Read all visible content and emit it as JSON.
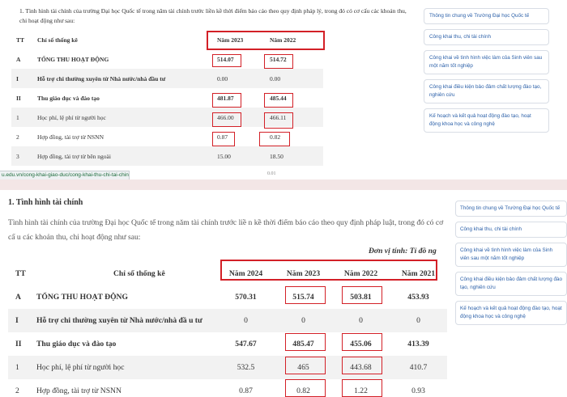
{
  "top": {
    "intro": "1. Tình hình tài chính của trường Đại học Quốc tế trong năm tài chính trước liền kề thời điểm báo cáo theo quy định pháp lý, trong đó có cơ cấu các khoản thu, chi hoạt động như sau:",
    "table": {
      "header": {
        "tt": "TT",
        "name": "Chỉ số thống kê",
        "y1": "Năm 2023",
        "y2": "Năm 2022"
      },
      "rows": [
        {
          "tt": "A",
          "name": "TỔNG THU HOẠT ĐỘNG",
          "y1": "514.07",
          "y2": "514.72"
        },
        {
          "tt": "I",
          "name": "Hỗ trợ chi thường xuyên từ Nhà nước/nhà đầu tư",
          "y1": "0.00",
          "y2": "0.00"
        },
        {
          "tt": "II",
          "name": "Thu giáo dục và đào tạo",
          "y1": "481.87",
          "y2": "485.44"
        },
        {
          "tt": "1",
          "name": "Học phí, lệ phí từ người học",
          "y1": "466.00",
          "y2": "466.11"
        },
        {
          "tt": "2",
          "name": "Hợp đồng, tài trợ từ NSNN",
          "y1": "0.87",
          "y2": "0.82"
        },
        {
          "tt": "3",
          "name": "Hợp đồng, tài trợ từ bên ngoài",
          "y1": "15.00",
          "y2": "18.50"
        }
      ],
      "cut_value": "0.01"
    },
    "sidebar": [
      "Thông tin chung về Trường Đại học Quốc tế",
      "Công khai thu, chi tài chính",
      "Công khai về tình hình việc làm của Sinh viên sau một năm tốt nghiệp",
      "Công khai điều kiện bảo đảm chất lượng đào tạo, nghiên cứu",
      "Kế hoạch và kết quả hoạt động đào tạo, hoạt động khoa học và công nghệ"
    ],
    "status_url": "u.edu.vn/cong-khai-giao-duc/cong-khai-thu-chi-tai-chinh/#"
  },
  "bottom": {
    "section_title": "1. Tình hình tài chính",
    "paragraph": "Tình hình tài chính của trường Đại học Quốc tế trong năm tài chính trước liề n kề thời điểm báo cáo theo quy định pháp luật, trong đó có cơ cấ u các khoản thu, chi hoạt động như sau:",
    "unit": "Đơn vị tính: Tỉ đồ ng",
    "table": {
      "header": {
        "tt": "TT",
        "name": "Chỉ số thống kê",
        "y2024": "Năm 2024",
        "y2023": "Năm 2023",
        "y2022": "Năm 2022",
        "y2021": "Năm 2021"
      },
      "rows": [
        {
          "tt": "A",
          "name": "TỔNG THU HOẠT ĐỘNG",
          "y2024": "570.31",
          "y2023": "515.74",
          "y2022": "503.81",
          "y2021": "453.93"
        },
        {
          "tt": "I",
          "name": "Hỗ trợ chi thường xuyên từ Nhà nước/nhà đầ u tư",
          "y2024": "0",
          "y2023": "0",
          "y2022": "0",
          "y2021": "0"
        },
        {
          "tt": "II",
          "name": "Thu giáo dục và đào tạo",
          "y2024": "547.67",
          "y2023": "485.47",
          "y2022": "455.06",
          "y2021": "413.39"
        },
        {
          "tt": "1",
          "name": "Học phí, lệ phí từ người học",
          "y2024": "532.5",
          "y2023": "465",
          "y2022": "443.68",
          "y2021": "410.7"
        },
        {
          "tt": "2",
          "name": "Hợp đồng, tài trợ từ NSNN",
          "y2024": "0.87",
          "y2023": "0.82",
          "y2022": "1.22",
          "y2021": "0.93"
        }
      ]
    },
    "sidebar": [
      "Thông tin chung về Trường Đại học Quốc tế",
      "Công khai thu, chi tài chính",
      "Công khai về tình hình việc làm của Sinh viên sau một năm tốt nghiệp",
      "Công khai điều kiện bảo đảm chất lượng đào tạo, nghiên cứu",
      "Kế hoạch và kết quả hoạt động đào tạo, hoạt động khoa học và công nghệ"
    ]
  },
  "colors": {
    "highlight": "#d32027",
    "link": "#2a5fa8",
    "row_shade": "#f2f2f2"
  }
}
